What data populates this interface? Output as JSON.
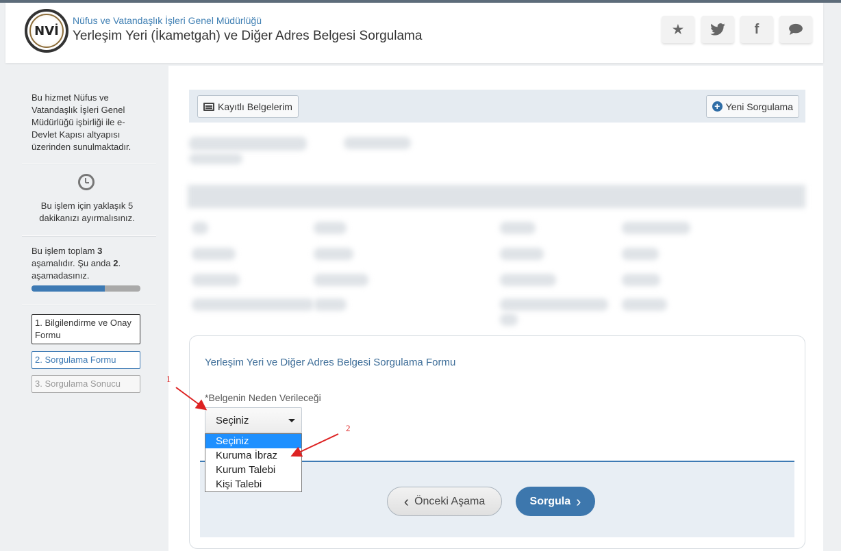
{
  "header": {
    "org_name": "Nüfus ve Vatandaşlık İşleri Genel Müdürlüğü",
    "logo_text": "NVİ",
    "title": "Yerleşim Yeri (İkametgah) ve Diğer Adres Belgesi Sorgulama",
    "buttons": [
      {
        "icon": "star-icon",
        "glyph": "★"
      },
      {
        "icon": "twitter-icon",
        "glyph": "🐦"
      },
      {
        "icon": "facebook-icon",
        "glyph": "f"
      },
      {
        "icon": "chat-icon",
        "glyph": "💬"
      }
    ]
  },
  "sidebar": {
    "info_text": "Bu hizmet Nüfus ve Vatandaşlık İşleri Genel Müdürlüğü işbirliği ile e-Devlet Kapısı altyapısı üzerinden sunulmaktadır.",
    "time_text": "Bu işlem için yaklaşık 5 dakikanızı ayırmalısınız.",
    "stage_text_prefix": "Bu işlem toplam ",
    "stage_total": "3",
    "stage_text_mid": " aşamalıdır. Şu anda ",
    "stage_current": "2",
    "stage_text_suffix": ". aşamadasınız.",
    "progress_fraction": 0.67,
    "steps": [
      {
        "label": "1. Bilgilendirme ve Onay Formu",
        "state": "done"
      },
      {
        "label": "2. Sorgulama Formu",
        "state": "active"
      },
      {
        "label": "3. Sorgulama Sonucu",
        "state": "pending"
      }
    ]
  },
  "toolbar": {
    "saved_docs_label": "Kayıtlı Belgelerim",
    "new_query_label": "Yeni Sorgulama"
  },
  "form": {
    "title": "Yerleşim Yeri ve Diğer Adres Belgesi Sorgulama Formu",
    "field_label": "*Belgenin Neden Verileceği",
    "select_value": "Seçiniz",
    "options": [
      "Seçiniz",
      "Kuruma İbraz",
      "Kurum Talebi",
      "Kişi Talebi"
    ],
    "prev_label": "Önceki Aşama",
    "submit_label": "Sorgula"
  },
  "annotations": {
    "marker_1": "1",
    "marker_2": "2",
    "color": "#dd2222"
  },
  "colors": {
    "accent": "#3d77ad",
    "link": "#3f7fb3"
  }
}
